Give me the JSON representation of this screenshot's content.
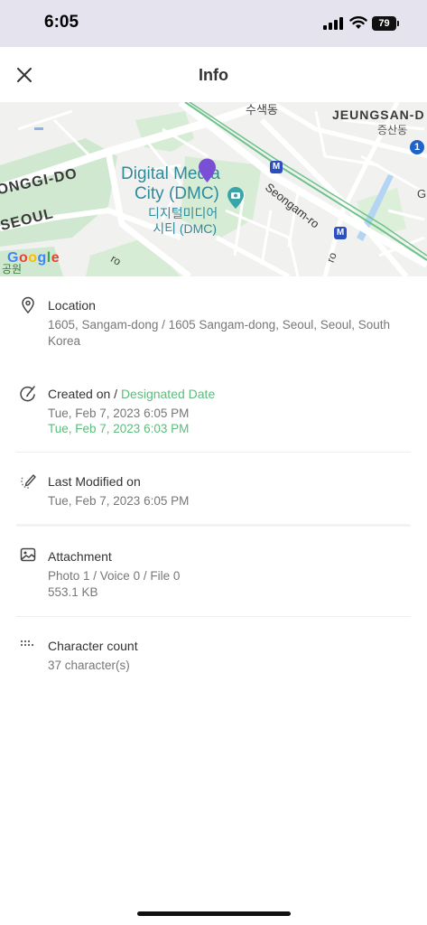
{
  "status_bar": {
    "time": "6:05",
    "battery": "79"
  },
  "header": {
    "title": "Info",
    "close_icon": "close-icon"
  },
  "map": {
    "labels": {
      "dmc_en_1": "Digital Media",
      "dmc_en_2": "City (DMC)",
      "dmc_ko_1": "디지털미디어",
      "dmc_ko_2": "시티 (DMC)",
      "gonggi": "ONGGI-DO",
      "seoul": "SEOUL",
      "jeungsan": "JEUNGSAN-D",
      "jeungsan_ko": "증산동",
      "suseok": "수색동",
      "seongam": "Seongam-ro",
      "ro_left": "ro",
      "ro_right": "ro",
      "gongwon": "공원",
      "g_right": "G"
    },
    "metro_label": "M",
    "route_number": "1",
    "attribution": "Google",
    "pin_color": "#7a4fd6"
  },
  "location": {
    "icon": "location-pin-icon",
    "title": "Location",
    "address": "1605, Sangam-dong / 1605 Sangam-dong, Seoul, Seoul, South Korea"
  },
  "created": {
    "icon": "clock-pen-icon",
    "title_prefix": "Created on / ",
    "title_accent": "Designated Date",
    "created_value": "Tue, Feb 7, 2023 6:05 PM",
    "designated_value": "Tue, Feb 7, 2023 6:03 PM",
    "accent_color": "#5cbc7c"
  },
  "modified": {
    "icon": "edit-pencil-icon",
    "title": "Last Modified on",
    "value": "Tue, Feb 7, 2023 6:05 PM"
  },
  "attachment": {
    "icon": "image-attachment-icon",
    "title": "Attachment",
    "counts": "Photo 1 / Voice 0 / File 0",
    "size": "553.1 KB"
  },
  "character_count": {
    "icon": "dots-icon",
    "title": "Character count",
    "value": "37 character(s)"
  }
}
